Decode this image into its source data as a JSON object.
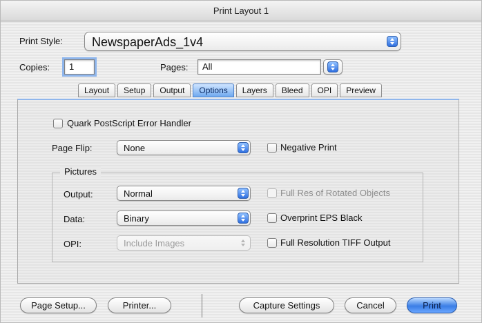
{
  "window": {
    "title": "Print Layout 1"
  },
  "print_style": {
    "label": "Print Style:",
    "value": "NewspaperAds_1v4"
  },
  "copies": {
    "label": "Copies:",
    "value": "1"
  },
  "pages": {
    "label": "Pages:",
    "value": "All"
  },
  "tabs": [
    {
      "label": "Layout",
      "active": false
    },
    {
      "label": "Setup",
      "active": false
    },
    {
      "label": "Output",
      "active": false
    },
    {
      "label": "Options",
      "active": true
    },
    {
      "label": "Layers",
      "active": false
    },
    {
      "label": "Bleed",
      "active": false
    },
    {
      "label": "OPI",
      "active": false
    },
    {
      "label": "Preview",
      "active": false
    }
  ],
  "options": {
    "error_handler": {
      "label": "Quark PostScript Error Handler",
      "checked": false
    },
    "page_flip": {
      "label": "Page Flip:",
      "value": "None"
    },
    "negative_print": {
      "label": "Negative Print",
      "checked": false
    },
    "pictures": {
      "title": "Pictures",
      "output": {
        "label": "Output:",
        "value": "Normal"
      },
      "data": {
        "label": "Data:",
        "value": "Binary"
      },
      "opi": {
        "label": "OPI:",
        "value": "Include Images",
        "enabled": false
      },
      "full_res_rotated": {
        "label": "Full Res of Rotated Objects",
        "checked": false,
        "enabled": false
      },
      "overprint_eps": {
        "label": "Overprint EPS Black",
        "checked": false
      },
      "full_res_tiff": {
        "label": "Full Resolution TIFF Output",
        "checked": false
      }
    }
  },
  "buttons": {
    "page_setup": "Page Setup...",
    "printer": "Printer...",
    "capture_settings": "Capture Settings",
    "cancel": "Cancel",
    "print": "Print"
  },
  "colors": {
    "accent": "#3a7ee6",
    "focus_ring": "#8fb6ec"
  }
}
